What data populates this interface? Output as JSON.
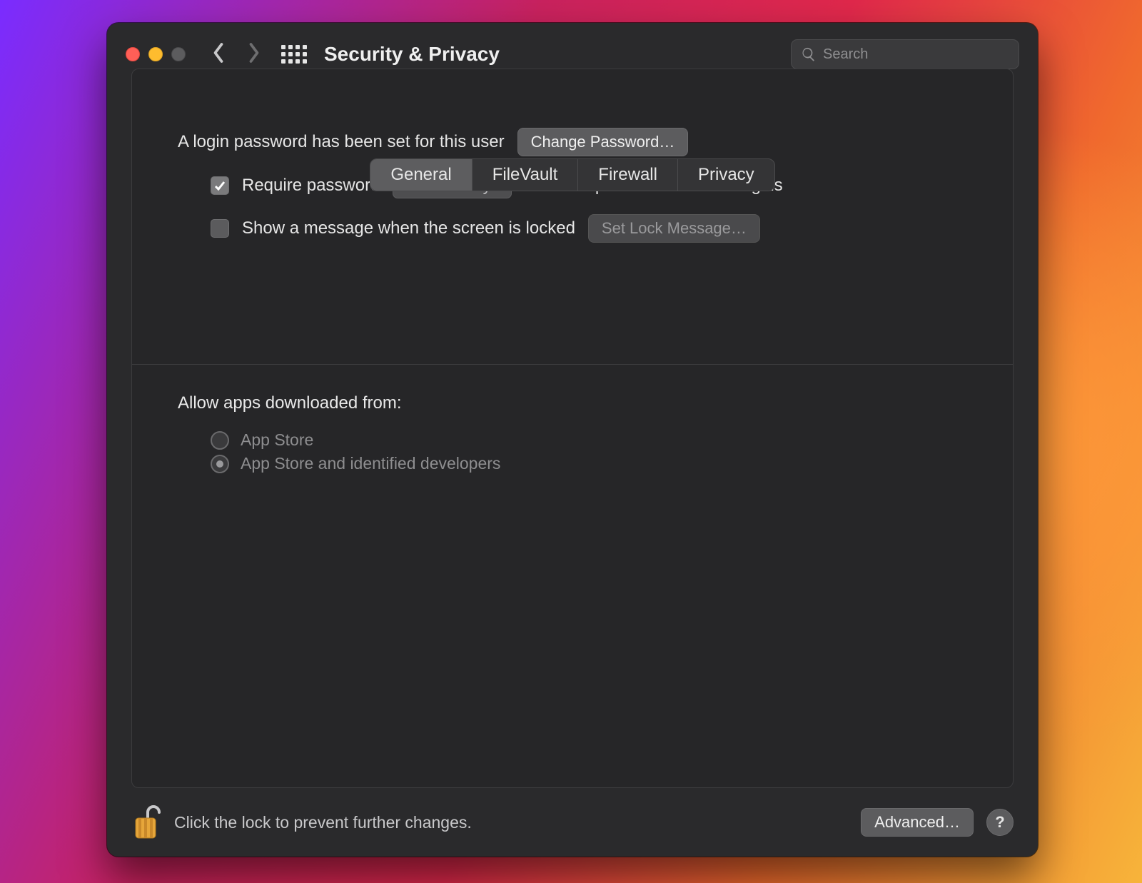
{
  "header": {
    "title": "Security & Privacy",
    "search_placeholder": "Search"
  },
  "tabs": {
    "general": "General",
    "filevault": "FileVault",
    "firewall": "Firewall",
    "privacy": "Privacy",
    "active": "general"
  },
  "general": {
    "login_password_set_label": "A login password has been set for this user",
    "change_password_button": "Change Password…",
    "require_password": {
      "checked": true,
      "label_before": "Require password",
      "select_value": "immediately",
      "label_after": "after sleep or screen saver begins"
    },
    "show_lock_message": {
      "checked": false,
      "label": "Show a message when the screen is locked",
      "button": "Set Lock Message…"
    },
    "allow_apps": {
      "title": "Allow apps downloaded from:",
      "options": {
        "app_store": "App Store",
        "app_store_and_identified": "App Store and identified developers"
      },
      "selected": "app_store_and_identified"
    }
  },
  "footer": {
    "lock_label": "Click the lock to prevent further changes.",
    "advanced_button": "Advanced…",
    "help_tooltip": "?"
  }
}
